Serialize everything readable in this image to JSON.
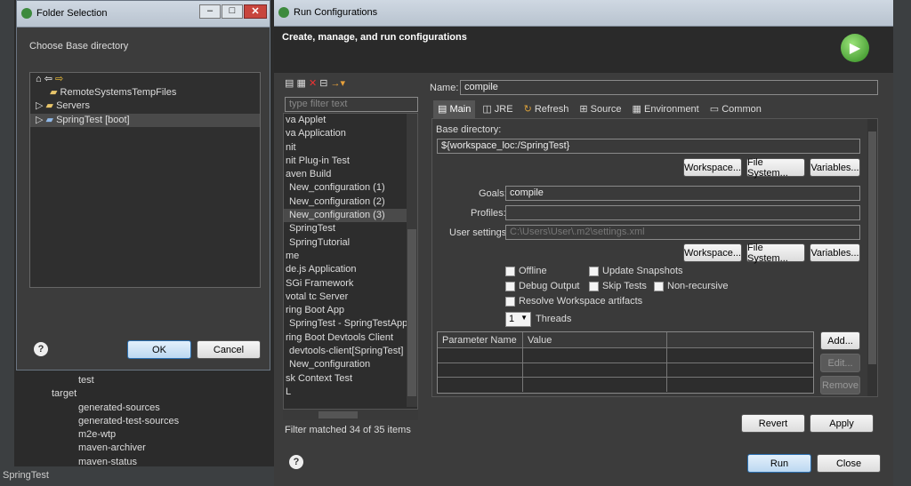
{
  "background": {
    "tree_items": [
      "test",
      "target",
      "generated-sources",
      "generated-test-sources",
      "m2e-wtp",
      "maven-archiver",
      "maven-status"
    ],
    "status": "SpringTest"
  },
  "folder_dialog": {
    "title": "Folder Selection",
    "heading": "Choose Base directory",
    "items": [
      "RemoteSystemsTempFiles",
      "Servers",
      "SpringTest [boot]"
    ],
    "ok": "OK",
    "cancel": "Cancel"
  },
  "run": {
    "title": "Run Configurations",
    "header": "Create, manage, and run configurations",
    "filter_placeholder": "type filter text",
    "configs": [
      "va Applet",
      "va Application",
      "nit",
      "nit Plug-in Test",
      "aven Build",
      "New_configuration (1)",
      "New_configuration (2)",
      "New_configuration (3)",
      "SpringTest",
      "SpringTutorial",
      "me",
      "de.js Application",
      "SGi Framework",
      "votal tc Server",
      "ring Boot App",
      "SpringTest - SpringTestApplic",
      "ring Boot Devtools Client",
      "devtools-client[SpringTest]",
      "New_configuration",
      "sk Context Test",
      "L"
    ],
    "filter_status": "Filter matched 34 of 35 items",
    "name_label": "Name:",
    "name_value": "compile",
    "tabs": [
      "Main",
      "JRE",
      "Refresh",
      "Source",
      "Environment",
      "Common"
    ],
    "base_dir_label": "Base directory:",
    "base_dir_value": "${workspace_loc:/SpringTest}",
    "workspace": "Workspace...",
    "filesystem": "File System...",
    "variables": "Variables...",
    "goals_label": "Goals:",
    "goals_value": "compile",
    "profiles_label": "Profiles:",
    "profiles_value": "",
    "settings_label": "User settings:",
    "settings_value": "C:\\Users\\User\\.m2\\settings.xml",
    "cb": {
      "offline": "Offline",
      "update": "Update Snapshots",
      "debug": "Debug Output",
      "skip": "Skip Tests",
      "nonrec": "Non-recursive",
      "resolve": "Resolve Workspace artifacts"
    },
    "threads_value": "1",
    "threads_label": "Threads",
    "param_col": "Parameter Name",
    "value_col": "Value",
    "add": "Add...",
    "edit": "Edit...",
    "remove": "Remove",
    "revert": "Revert",
    "apply": "Apply",
    "run_btn": "Run",
    "close": "Close"
  }
}
